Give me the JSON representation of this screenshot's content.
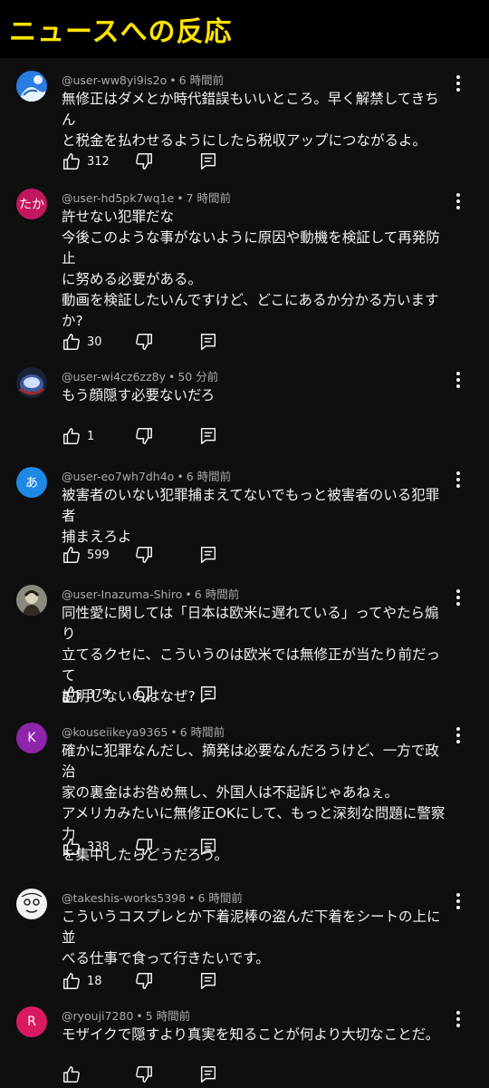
{
  "header": {
    "title": "ニュースへの反応"
  },
  "comments": [
    {
      "user": "@user-ww8yi9is2o",
      "time": "6 時間前",
      "likes": "312",
      "lines": [
        "無修正はダメとか時代錯誤もいいところ。早く解禁してきちん",
        "と税金を払わせるようにしたら税収アップにつながるよ。"
      ],
      "avatar": {
        "type": "image",
        "name": "avatar-blue-image"
      }
    },
    {
      "user": "@user-hd5pk7wq1e",
      "time": "7 時間前",
      "likes": "30",
      "lines": [
        "許せない犯罪だな",
        "今後このような事がないように原因や動機を検証して再発防止",
        "に努める必要がある。",
        "動画を検証したいんですけど、どこにあるか分かる方います",
        "か?"
      ],
      "avatar": {
        "type": "text",
        "text": "たか",
        "color": "#c2185b"
      }
    },
    {
      "user": "@user-wi4cz6zz8y",
      "time": "50 分前",
      "likes": "1",
      "lines": [
        "もう顔隠す必要ないだろ"
      ],
      "avatar": {
        "type": "image",
        "name": "avatar-helmet-image"
      }
    },
    {
      "user": "@user-eo7wh7dh4o",
      "time": "6 時間前",
      "likes": "599",
      "lines": [
        "被害者のいない犯罪捕まえてないでもっと被害者のいる犯罪者",
        "捕まえろよ"
      ],
      "avatar": {
        "type": "text",
        "text": "あ",
        "color": "#1e88e5"
      }
    },
    {
      "user": "@user-Inazuma-Shiro",
      "time": "6 時間前",
      "likes": "379",
      "lines": [
        "同性愛に関しては「日本は欧米に遅れている」ってやたら煽り",
        "立てるクセに、こういうのは欧米では無修正が当たり前だって",
        "説明しないのはなぜ?"
      ],
      "avatar": {
        "type": "image",
        "name": "avatar-portrait-image"
      }
    },
    {
      "user": "@kouseiikeya9365",
      "time": "6 時間前",
      "likes": "338",
      "lines": [
        "確かに犯罪なんだし、摘発は必要なんだろうけど、一方で政治",
        "家の裏金はお咎め無し、外国人は不起訴じゃあねぇ。",
        "アメリカみたいに無修正OKにして、もっと深刻な問題に警察力",
        "を集中したらどうだろう。"
      ],
      "avatar": {
        "type": "text",
        "text": "K",
        "color": "#8e24aa"
      }
    },
    {
      "user": "@takeshis-works5398",
      "time": "6 時間前",
      "likes": "18",
      "lines": [
        "こういうコスプレとか下着泥棒の盗んだ下着をシートの上に並",
        "べる仕事で食って行きたいです。"
      ],
      "avatar": {
        "type": "image",
        "name": "avatar-face-sketch-image"
      }
    },
    {
      "user": "@ryouji7280",
      "time": "5 時間前",
      "likes": "",
      "lines": [
        "モザイクで隠すより真実を知ることが何より大切なことだ。"
      ],
      "avatar": {
        "type": "text",
        "text": "R",
        "color": "#d81b60"
      }
    }
  ],
  "colors": {
    "background": "#0f0f0f",
    "text": "#f1f1f1",
    "meta": "#aaaaaa",
    "banner_text": "#ffe400"
  },
  "icons": {
    "like": "thumbs-up-icon",
    "dislike": "thumbs-down-icon",
    "reply": "reply-icon",
    "menu": "more-vert-icon"
  }
}
